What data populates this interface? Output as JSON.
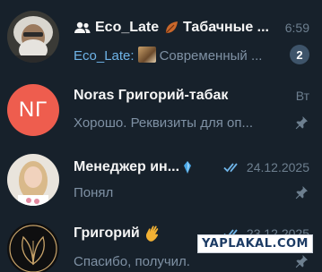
{
  "chats": [
    {
      "title": "Eco_Late",
      "title_suffix": "Табачные ...",
      "is_group": true,
      "time": "6:59",
      "sender": "Eco_Late:",
      "preview": "Современный ...",
      "unread": "2",
      "avatar_kind": "photo-elderly-man"
    },
    {
      "title": "Noras Григорий-табак",
      "time": "Вт",
      "preview": "Хорошо. Реквизиты для оп...",
      "avatar_initials": "NГ",
      "pinned": true
    },
    {
      "title": "Менеджер ин...",
      "time": "24.12.2025",
      "preview": "Понял",
      "read": true,
      "pinned": true,
      "avatar_kind": "photo-woman"
    },
    {
      "title": "Григорий",
      "time": "23.12.2025",
      "preview": "Спасибо, получил.",
      "read": true,
      "pinned": true,
      "avatar_kind": "logo-leaf"
    }
  ],
  "watermark": "YAPLAKAL.COM",
  "colors": {
    "background": "#17212b",
    "accent": "#6fb4e8",
    "avatar_red": "#ee5d4e",
    "badge": "#3e546a"
  }
}
